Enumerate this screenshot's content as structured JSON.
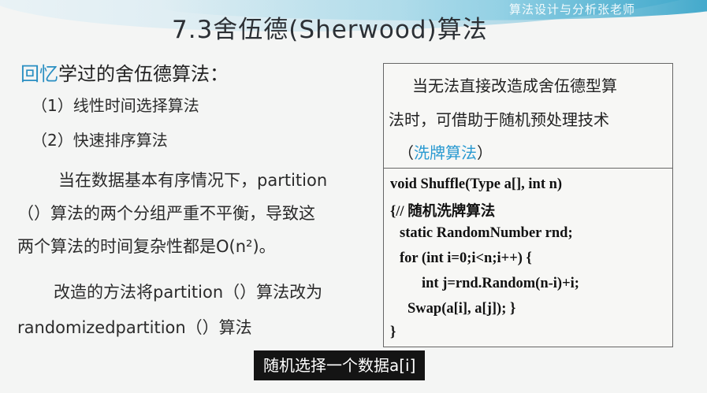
{
  "watermark": "算法设计与分析张老师",
  "title": "7.3舍伍德(Sherwood)算法",
  "recall": {
    "accent": "回忆",
    "rest": "学过的舍伍德算法："
  },
  "items": [
    "（1）线性时间选择算法",
    "（2）快速排序算法"
  ],
  "paragraph1": [
    "当在数据基本有序情况下，partition",
    "（）算法的两个分组严重不平衡，导致这",
    "两个算法的时间复杂性都是O(n²)。"
  ],
  "paragraph2": [
    "改造的方法将partition（）算法改为",
    "randomizedpartition（）算法"
  ],
  "box_text": {
    "line1": "当无法直接改造成舍伍德型算",
    "line2": "法时，可借助于随机预处理技术",
    "line3_open": "（",
    "line3_accent": "洗牌算法",
    "line3_close": "）"
  },
  "code": [
    "void Shuffle(Type a[], int n)",
    "{// 随机洗牌算法",
    "static RandomNumber rnd;",
    "for (int i=0;i<n;i++) {",
    "int j=rnd.Random(n-i)+i;",
    "Swap(a[i], a[j]);   }",
    "}"
  ],
  "subtitle": "随机选择一个数据a[i]",
  "colors": {
    "accent": "#2a8fc2",
    "title": "#2c3035",
    "subtitle_bg": "#141414"
  }
}
